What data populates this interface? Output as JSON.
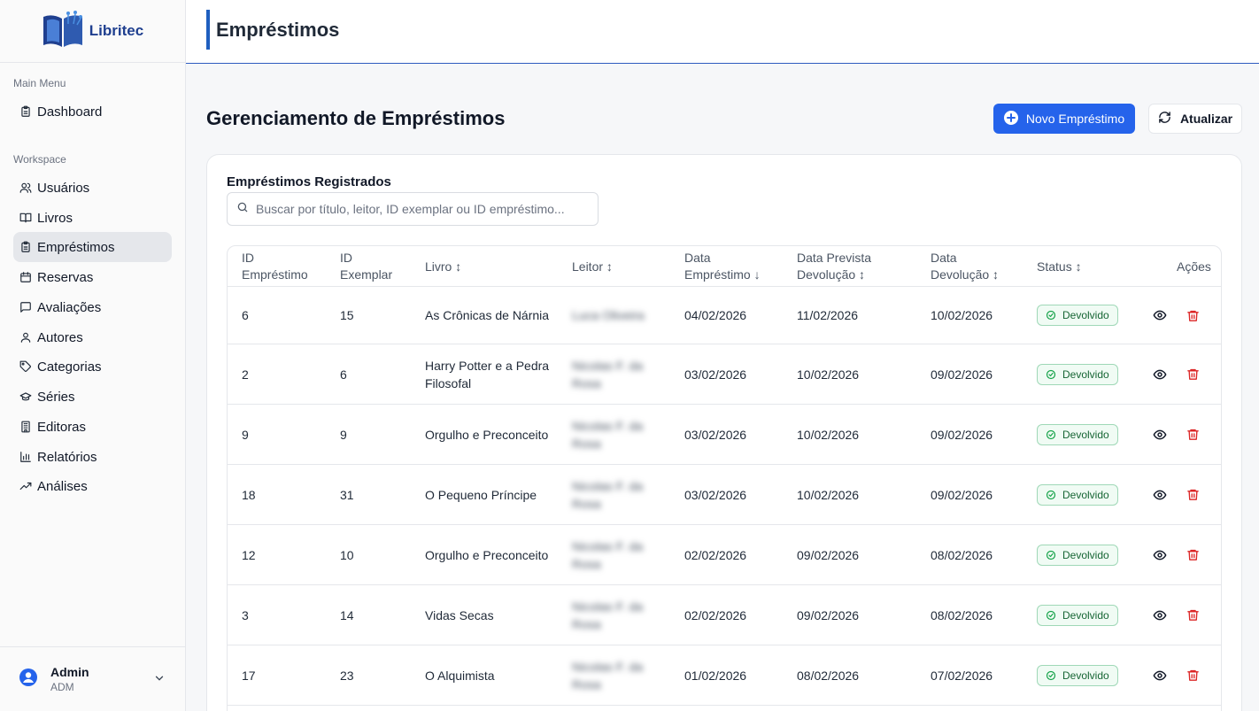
{
  "brand": {
    "name": "Libritec"
  },
  "sidebar": {
    "sections": [
      {
        "label": "Main Menu"
      },
      {
        "label": "Workspace"
      }
    ],
    "items": [
      {
        "label": "Dashboard",
        "icon": "clipboard-icon"
      },
      {
        "label": "Usuários",
        "icon": "users-icon"
      },
      {
        "label": "Livros",
        "icon": "book-icon"
      },
      {
        "label": "Empréstimos",
        "icon": "clipboard-icon",
        "active": true
      },
      {
        "label": "Reservas",
        "icon": "calendar-icon"
      },
      {
        "label": "Avaliações",
        "icon": "message-icon"
      },
      {
        "label": "Autores",
        "icon": "user-icon"
      },
      {
        "label": "Categorias",
        "icon": "tag-icon"
      },
      {
        "label": "Séries",
        "icon": "graduation-cap-icon"
      },
      {
        "label": "Editoras",
        "icon": "building-icon"
      },
      {
        "label": "Relatórios",
        "icon": "bar-chart-icon"
      },
      {
        "label": "Análises",
        "icon": "trending-up-icon"
      }
    ],
    "user": {
      "name": "Admin",
      "role": "ADM"
    }
  },
  "header": {
    "title": "Empréstimos"
  },
  "main": {
    "title": "Gerenciamento de Empréstimos",
    "new_button": "Novo Empréstimo",
    "refresh_button": "Atualizar",
    "card_title": "Empréstimos Registrados",
    "search_placeholder": "Buscar por título, leitor, ID exemplar ou ID empréstimo...",
    "columns": [
      {
        "line1": "ID",
        "line2": "Empréstimo"
      },
      {
        "line1": "ID",
        "line2": "Exemplar"
      },
      {
        "line1": "Livro ↕",
        "line2": ""
      },
      {
        "line1": "Leitor ↕",
        "line2": ""
      },
      {
        "line1": "Data",
        "line2": "Empréstimo ↓"
      },
      {
        "line1": "Data Prevista",
        "line2": "Devolução ↕"
      },
      {
        "line1": "Data",
        "line2": "Devolução ↕"
      },
      {
        "line1": "Status ↕",
        "line2": ""
      },
      {
        "line1": "Ações",
        "line2": ""
      }
    ],
    "rows": [
      {
        "id": "6",
        "exemplar": "15",
        "livro": "As Crônicas de Nárnia",
        "leitor": "Luca Oliveira",
        "data_emprestimo": "04/02/2026",
        "data_prevista": "11/02/2026",
        "data_devolucao": "10/02/2026",
        "status": "Devolvido"
      },
      {
        "id": "2",
        "exemplar": "6",
        "livro": "Harry Potter e a Pedra Filosofal",
        "leitor": "Nicolas F. da Rosa",
        "data_emprestimo": "03/02/2026",
        "data_prevista": "10/02/2026",
        "data_devolucao": "09/02/2026",
        "status": "Devolvido"
      },
      {
        "id": "9",
        "exemplar": "9",
        "livro": "Orgulho e Preconceito",
        "leitor": "Nicolas F. da Rosa",
        "data_emprestimo": "03/02/2026",
        "data_prevista": "10/02/2026",
        "data_devolucao": "09/02/2026",
        "status": "Devolvido"
      },
      {
        "id": "18",
        "exemplar": "31",
        "livro": "O Pequeno Príncipe",
        "leitor": "Nicolas F. da Rosa",
        "data_emprestimo": "03/02/2026",
        "data_prevista": "10/02/2026",
        "data_devolucao": "09/02/2026",
        "status": "Devolvido"
      },
      {
        "id": "12",
        "exemplar": "10",
        "livro": "Orgulho e Preconceito",
        "leitor": "Nicolas F. da Rosa",
        "data_emprestimo": "02/02/2026",
        "data_prevista": "09/02/2026",
        "data_devolucao": "08/02/2026",
        "status": "Devolvido"
      },
      {
        "id": "3",
        "exemplar": "14",
        "livro": "Vidas Secas",
        "leitor": "Nicolas F. da Rosa",
        "data_emprestimo": "02/02/2026",
        "data_prevista": "09/02/2026",
        "data_devolucao": "08/02/2026",
        "status": "Devolvido"
      },
      {
        "id": "17",
        "exemplar": "23",
        "livro": "O Alquimista",
        "leitor": "Nicolas F. da Rosa",
        "data_emprestimo": "01/02/2026",
        "data_prevista": "08/02/2026",
        "data_devolucao": "07/02/2026",
        "status": "Devolvido"
      }
    ]
  },
  "colors": {
    "primary": "#2563eb",
    "danger": "#dc2626",
    "success": "#16a34a",
    "brand": "#1f3f8f"
  }
}
